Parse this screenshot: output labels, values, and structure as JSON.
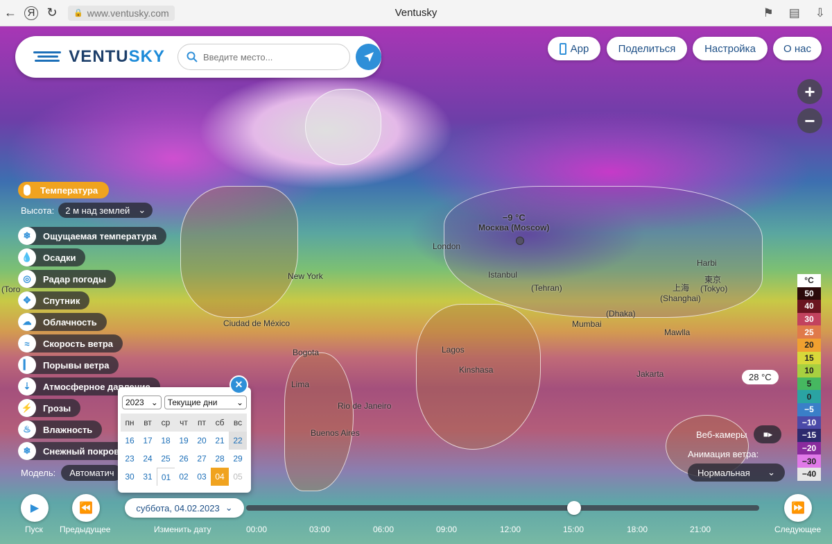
{
  "browser": {
    "url": "www.ventusky.com",
    "title": "Ventusky",
    "yandex_glyph": "Я"
  },
  "header": {
    "logo_text_part1": "VENTU",
    "logo_text_part2": "SKY",
    "search_placeholder": "Введите место...",
    "buttons": {
      "app": "App",
      "share": "Поделиться",
      "settings": "Настройка",
      "about": "О нас"
    }
  },
  "zoom": {
    "in": "+",
    "out": "−"
  },
  "map": {
    "cities": [
      {
        "name": "London"
      },
      {
        "name": "Istanbul"
      },
      {
        "name": "(Tehran)"
      },
      {
        "name": "Mumbai"
      },
      {
        "name": "(Dhaka)"
      },
      {
        "name": "上海"
      },
      {
        "name": "(Shanghai)"
      },
      {
        "name": "東京"
      },
      {
        "name": "(Tokyo)"
      },
      {
        "name": "Mawlla"
      },
      {
        "name": "Jakarta"
      },
      {
        "name": "Lagos"
      },
      {
        "name": "Kinshasa"
      },
      {
        "name": "Ciudad de México"
      },
      {
        "name": "Bogota"
      },
      {
        "name": "Lima"
      },
      {
        "name": "Rio de Janeiro"
      },
      {
        "name": "Buenos Aires"
      },
      {
        "name": "New York"
      },
      {
        "name": "(Toro"
      },
      {
        "name": "Harbi"
      }
    ],
    "selected_city": {
      "temp": "−9 °C",
      "name": "Москва (Moscow)"
    }
  },
  "layers": {
    "active": "Температура",
    "height_label": "Высота:",
    "height_value": "2 м над землей",
    "items": [
      "Ощущаемая температура",
      "Осадки",
      "Радар погоды",
      "Спутник",
      "Облачность",
      "Скорость ветра",
      "Порывы ветра",
      "Атмосферное давление",
      "Грозы",
      "Влажность",
      "Снежный покров"
    ],
    "model_label": "Модель:",
    "model_value": "Автоматич"
  },
  "calendar": {
    "year": "2023",
    "range": "Текущие дни",
    "weekdays": [
      "пн",
      "вт",
      "ср",
      "чт",
      "пт",
      "сб",
      "вс"
    ],
    "rows": [
      [
        "16",
        "17",
        "18",
        "19",
        "20",
        "21",
        "22"
      ],
      [
        "23",
        "24",
        "25",
        "26",
        "27",
        "28",
        "29"
      ],
      [
        "30",
        "31",
        "01",
        "02",
        "03",
        "04",
        "05"
      ]
    ],
    "selected": "04",
    "disabled": "05"
  },
  "legend": {
    "unit": "°C",
    "items": [
      {
        "label": "50",
        "color": "#2b0a0a",
        "text": "#ffffff"
      },
      {
        "label": "40",
        "color": "#6b1420",
        "text": "#ffffff"
      },
      {
        "label": "30",
        "color": "#c2425e",
        "text": "#ffffff"
      },
      {
        "label": "25",
        "color": "#e07a4a",
        "text": "#ffffff"
      },
      {
        "label": "20",
        "color": "#f0a030",
        "text": "#222222"
      },
      {
        "label": "15",
        "color": "#d8d83a",
        "text": "#222222"
      },
      {
        "label": "10",
        "color": "#a8d040",
        "text": "#222222"
      },
      {
        "label": "5",
        "color": "#46b860",
        "text": "#222222"
      },
      {
        "label": "0",
        "color": "#2aa3a3",
        "text": "#222222"
      },
      {
        "label": "−5",
        "color": "#3a7fc8",
        "text": "#ffffff"
      },
      {
        "label": "−10",
        "color": "#4b4aa8",
        "text": "#ffffff"
      },
      {
        "label": "−15",
        "color": "#2d2a6e",
        "text": "#ffffff"
      },
      {
        "label": "−20",
        "color": "#8a2b9e",
        "text": "#ffffff"
      },
      {
        "label": "−30",
        "color": "#e079e8",
        "text": "#222222"
      },
      {
        "label": "−40",
        "color": "#e6e6e6",
        "text": "#222222"
      }
    ]
  },
  "temp_bubble": "28 °C",
  "webcams": {
    "label": "Веб-камеры"
  },
  "wind_animation": {
    "label": "Анимация ветра:",
    "value": "Нормальная"
  },
  "timeline": {
    "play_label": "Пуск",
    "prev_label": "Предыдущее",
    "change_date_label": "Изменить дату",
    "next_label": "Следующее",
    "date": "суббота, 04.02.2023",
    "ticks": [
      "00:00",
      "03:00",
      "06:00",
      "09:00",
      "12:00",
      "15:00",
      "18:00",
      "21:00"
    ],
    "current_time": "14:30"
  }
}
